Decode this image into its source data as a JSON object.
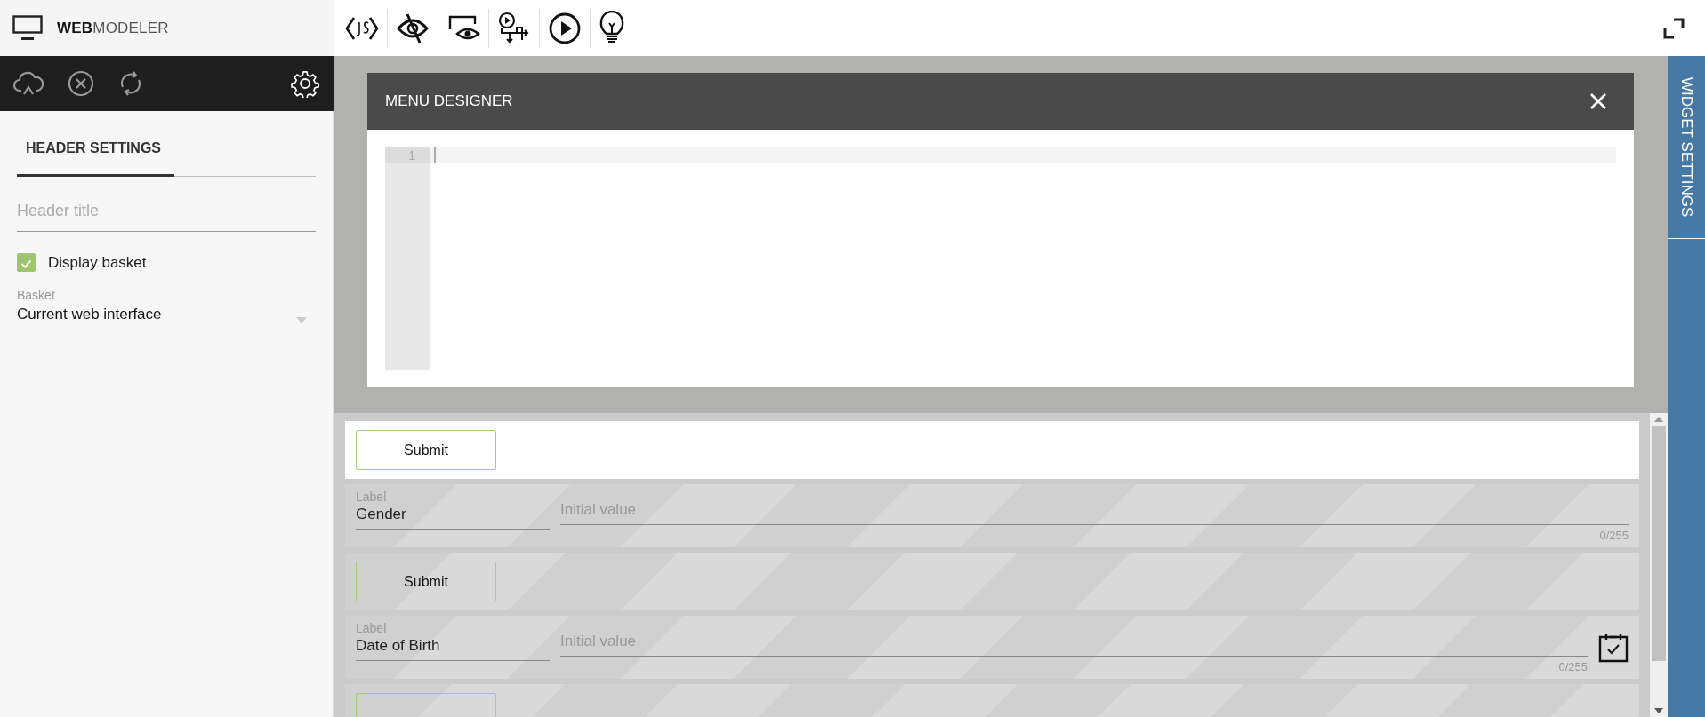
{
  "app": {
    "title_bold": "WEB",
    "title_rest": "MODELER"
  },
  "left_panel": {
    "tabs": [
      {
        "label": "HEADER SETTINGS",
        "selected": true
      }
    ],
    "header_title": {
      "placeholder": "Header title"
    },
    "display_basket": {
      "label": "Display basket",
      "checked": true
    },
    "basket": {
      "label": "Basket",
      "value": "Current web interface"
    }
  },
  "dialog": {
    "title": "MENU DESIGNER",
    "editor": {
      "line_numbers": [
        "1"
      ]
    }
  },
  "widgets": [
    {
      "kind": "button",
      "label": "Submit",
      "selected": true
    },
    {
      "kind": "text_field",
      "caption": "Label",
      "label_value": "Gender",
      "placeholder": "Initial value",
      "counter": "0/255",
      "calendar": false,
      "selected": false
    },
    {
      "kind": "button",
      "label": "Submit",
      "selected": false
    },
    {
      "kind": "text_field",
      "caption": "Label",
      "label_value": "Date of Birth",
      "placeholder": "Initial value",
      "counter": "0/255",
      "calendar": true,
      "selected": false
    },
    {
      "kind": "button",
      "selected": false
    }
  ],
  "side_tab": {
    "label": "WIDGET SETTINGS"
  }
}
